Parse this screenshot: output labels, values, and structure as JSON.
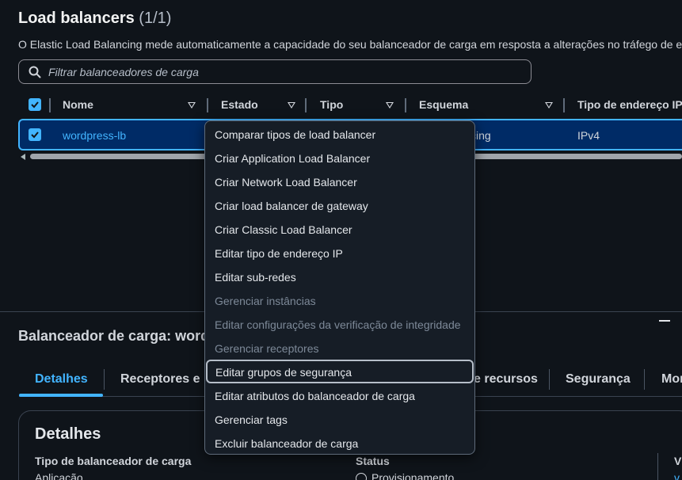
{
  "header": {
    "title": "Load balancers",
    "count": "(1/1)",
    "description": "O Elastic Load Balancing mede automaticamente a capacidade do seu balanceador de carga em resposta a alterações no tráfego de e"
  },
  "search": {
    "placeholder": "Filtrar balanceadores de carga"
  },
  "table": {
    "columns": [
      "Nome",
      "Estado",
      "Tipo",
      "Esquema",
      "Tipo de endereço IP"
    ],
    "rows": [
      {
        "name": "wordpress-lb",
        "scheme_partial": "cing",
        "ip_type": "IPv4",
        "selected": true
      }
    ]
  },
  "menu": {
    "items": [
      {
        "label": "Comparar tipos de load balancer",
        "disabled": false
      },
      {
        "label": "Criar Application Load Balancer",
        "disabled": false
      },
      {
        "label": "Criar Network Load Balancer",
        "disabled": false
      },
      {
        "label": "Criar load balancer de gateway",
        "disabled": false
      },
      {
        "label": "Criar Classic Load Balancer",
        "disabled": false
      },
      {
        "label": "Editar tipo de endereço IP",
        "disabled": false
      },
      {
        "label": "Editar sub-redes",
        "disabled": false
      },
      {
        "label": "Gerenciar instâncias",
        "disabled": true
      },
      {
        "label": "Editar configurações da verificação de integridade",
        "disabled": true
      },
      {
        "label": "Gerenciar receptores",
        "disabled": true
      },
      {
        "label": "Editar grupos de segurança",
        "disabled": false,
        "focused": true
      },
      {
        "label": "Editar atributos do balanceador de carga",
        "disabled": false
      },
      {
        "label": "Gerenciar tags",
        "disabled": false
      },
      {
        "label": "Excluir balanceador de carga",
        "disabled": false
      }
    ]
  },
  "details_panel": {
    "title": "Balanceador de carga: wordp",
    "tabs": [
      "Detalhes",
      "Receptores e r",
      "e recursos",
      "Segurança",
      "Mor"
    ],
    "active_tab": "Detalhes",
    "card_title": "Detalhes",
    "fields": {
      "type_label": "Tipo de balanceador de carga",
      "type_value": "Aplicação",
      "status_label": "Status",
      "status_value": "Provisionamento",
      "third_label": "V",
      "third_value": "v"
    }
  },
  "colors": {
    "background": "#0f141a",
    "accent": "#42b4ff",
    "selected_row": "#002b66",
    "menu_bg": "#161d26"
  },
  "icons": [
    "search-icon",
    "check-icon",
    "sort-caret-icon",
    "minimize-icon",
    "status-pending-icon"
  ]
}
